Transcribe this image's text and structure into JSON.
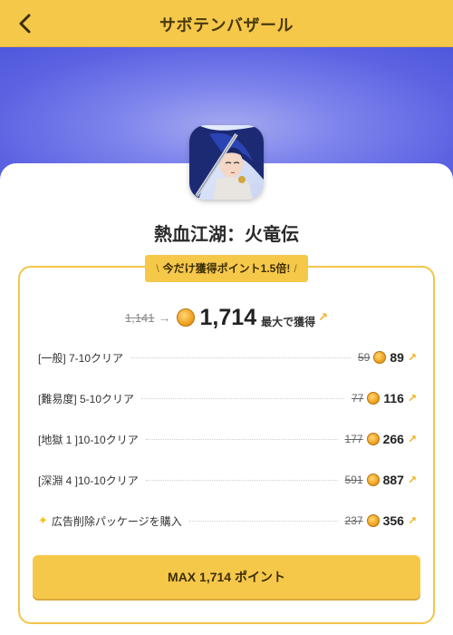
{
  "header": {
    "title": "サボテンバザール",
    "back_icon": "chevron-left-icon"
  },
  "app": {
    "name": "熱血江湖：火竜伝",
    "icon": "app-icon"
  },
  "promo": {
    "text": "今だけ獲得ポイント1.5倍!"
  },
  "total": {
    "old_value": "1,141",
    "value": "1,714",
    "suffix": "最大で獲得"
  },
  "tasks": [
    {
      "label": "[一般] 7-10クリア",
      "old_points": "59",
      "points": "89"
    },
    {
      "label": "[難易度] 5-10クリア",
      "old_points": "77",
      "points": "116"
    },
    {
      "label": "[地獄 1 ]10-10クリア",
      "old_points": "177",
      "points": "266"
    },
    {
      "label": "[深淵 4 ]10-10クリア",
      "old_points": "591",
      "points": "887"
    },
    {
      "label": "広告削除パッケージを購入",
      "old_points": "237",
      "points": "356",
      "icon": "sparkle-icon"
    }
  ],
  "cta": {
    "label": "MAX 1,714 ポイント"
  },
  "colors": {
    "accent": "#f6c84a",
    "hero_blue": "#5b62e2",
    "coin": "#f0a31e"
  }
}
